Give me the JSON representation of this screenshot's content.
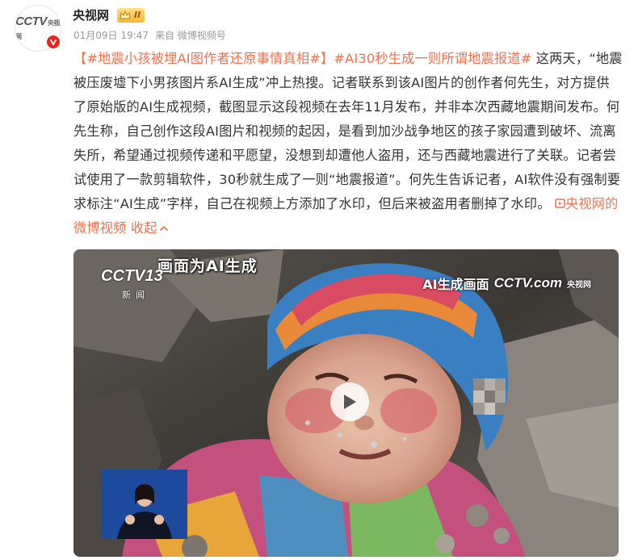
{
  "author": {
    "name": "央视网",
    "avatar_text": "CCTV",
    "avatar_sub": "央视网",
    "badge_level": "II",
    "verified_color": "#e2261e"
  },
  "meta": {
    "date": "01月09日 19:47",
    "source": "来自 微博视频号"
  },
  "post": {
    "topic1": "【#地震小孩被埋AI图作者还原事情真相#】",
    "topic2": "#AI30秒生成一则所谓地震报道#",
    "body": " 这两天，“地震被压废墟下小男孩图片系AI生成”冲上热搜。记者联系到该AI图片的创作者何先生，对方提供了原始版的AI生成视频，截图显示这段视频在去年11月发布，并非本次西藏地震期间发布。何先生称，自己创作这段AI图片和视频的起因，是看到加沙战争地区的孩子家园遭到破坏、流离失所，希望通过视频传递和平愿望，没想到却遭他人盗用，还与西藏地震进行了关联。记者尝试使用了一款剪辑软件，30秒就生成了一则“地震报道”。何先生告诉记者，AI软件没有强制要求标注“AI生成”字样，自己在视频上方添加了水印，但后来被盗用者删掉了水印。",
    "video_link": "央视网的微博视频",
    "collapse": "收起",
    "link_color": "#eb7350"
  },
  "video": {
    "watermark_topleft": "画面为AI生成",
    "channel_logo": "CCTV13",
    "channel_sub": "新闻",
    "watermark_topright": "AI生成画面",
    "brand_logo": "CCTV.com",
    "brand_sub": "央视网",
    "play_icon": "play-icon"
  }
}
